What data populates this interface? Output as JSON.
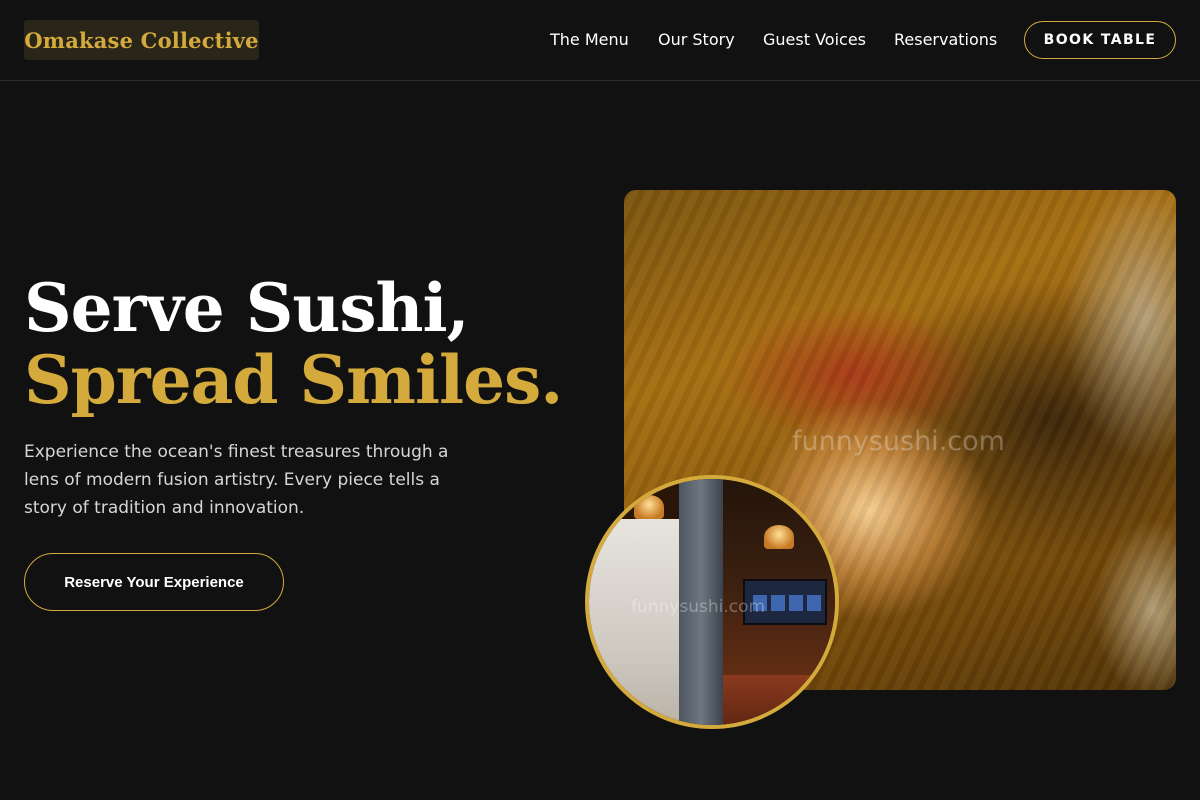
{
  "header": {
    "logo": "Omakase Collective",
    "nav": [
      {
        "label": "The Menu"
      },
      {
        "label": "Our Story"
      },
      {
        "label": "Guest Voices"
      },
      {
        "label": "Reservations"
      }
    ],
    "cta_label": "BOOK TABLE"
  },
  "hero": {
    "title_line1": "Serve Sushi,",
    "title_line2": "Spread Smiles.",
    "description": "Experience the ocean's finest treasures through a lens of modern fusion artistry. Every piece tells a story of tradition and innovation.",
    "cta_label": "Reserve Your Experience",
    "image_watermark": "funnysushi.com",
    "inset_watermark": "funnysushi.com"
  },
  "colors": {
    "background": "#111111",
    "accent_gold": "#d4aa3c",
    "text": "#ffffff",
    "muted_text": "#d6d6d6"
  }
}
